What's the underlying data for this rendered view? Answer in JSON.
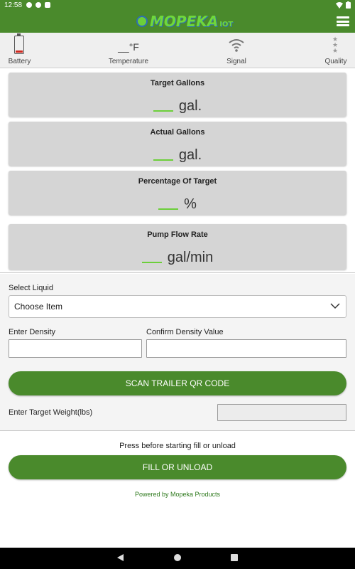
{
  "status_bar": {
    "time": "12:58"
  },
  "app_bar": {
    "logo_text": "MOPEKA",
    "logo_sub": "IOT"
  },
  "sensors": {
    "battery_label": "Battery",
    "temperature_value": "__°F",
    "temperature_label": "Temperature",
    "signal_label": "Signal",
    "quality_label": "Quality"
  },
  "cards": [
    {
      "title": "Target Gallons",
      "unit": "gal."
    },
    {
      "title": "Actual Gallons",
      "unit": "gal."
    },
    {
      "title": "Percentage Of Target",
      "unit": "%"
    },
    {
      "title": "Pump Flow Rate",
      "unit": "gal/min"
    }
  ],
  "form": {
    "select_liquid_label": "Select Liquid",
    "select_liquid_value": "Choose Item",
    "enter_density_label": "Enter Density",
    "confirm_density_label": "Confirm Density Value",
    "scan_button": "SCAN TRAILER QR CODE",
    "target_weight_label": "Enter Target Weight(lbs)"
  },
  "footer": {
    "note": "Press before starting fill or unload",
    "fill_button": "FILL OR UNLOAD",
    "powered_by": "Powered by Mopeka Products"
  },
  "colors": {
    "primary_green": "#4a8a2c",
    "accent_green": "#6ccf3a",
    "battery_low": "#d0281e"
  }
}
